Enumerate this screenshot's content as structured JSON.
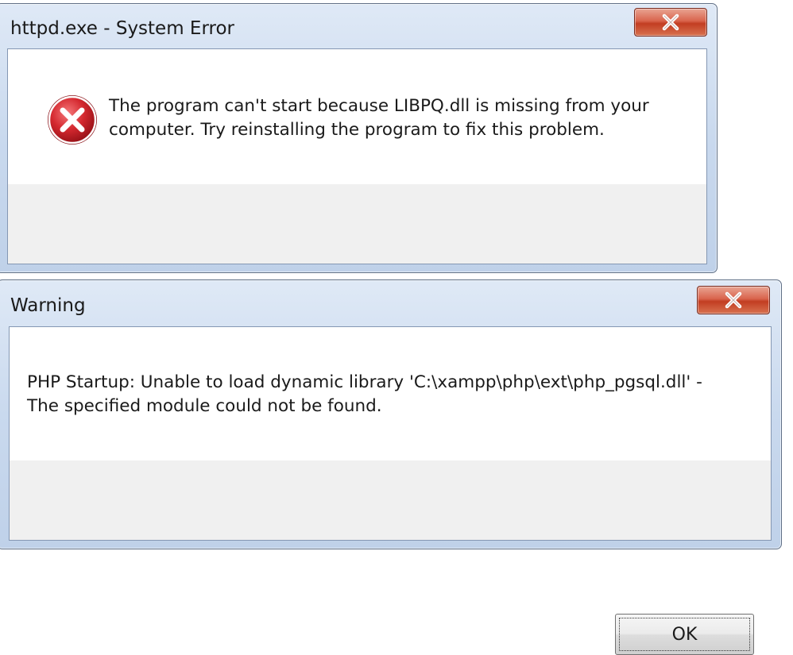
{
  "dialogs": [
    {
      "title": "httpd.exe - System Error",
      "icon": "error-icon",
      "message_lines": [
        "The program can't start because LIBPQ.dll is missing from your",
        "computer. Try reinstalling the program to fix this problem."
      ],
      "ok_label": "OK",
      "close_icon": "close-icon"
    },
    {
      "title": "Warning",
      "message_lines": [
        "PHP Startup: Unable to load dynamic library 'C:\\xampp\\php\\ext\\php_pgsql.dll' -",
        "The specified module could not be found."
      ],
      "ok_label": "OK",
      "close_icon": "close-icon"
    }
  ],
  "colors": {
    "title_bar": "#c9d9ee",
    "close_button": "#c23d22",
    "error_red": "#c0202a",
    "client_bg": "#ffffff",
    "footer_bg": "#f0f0f0"
  }
}
